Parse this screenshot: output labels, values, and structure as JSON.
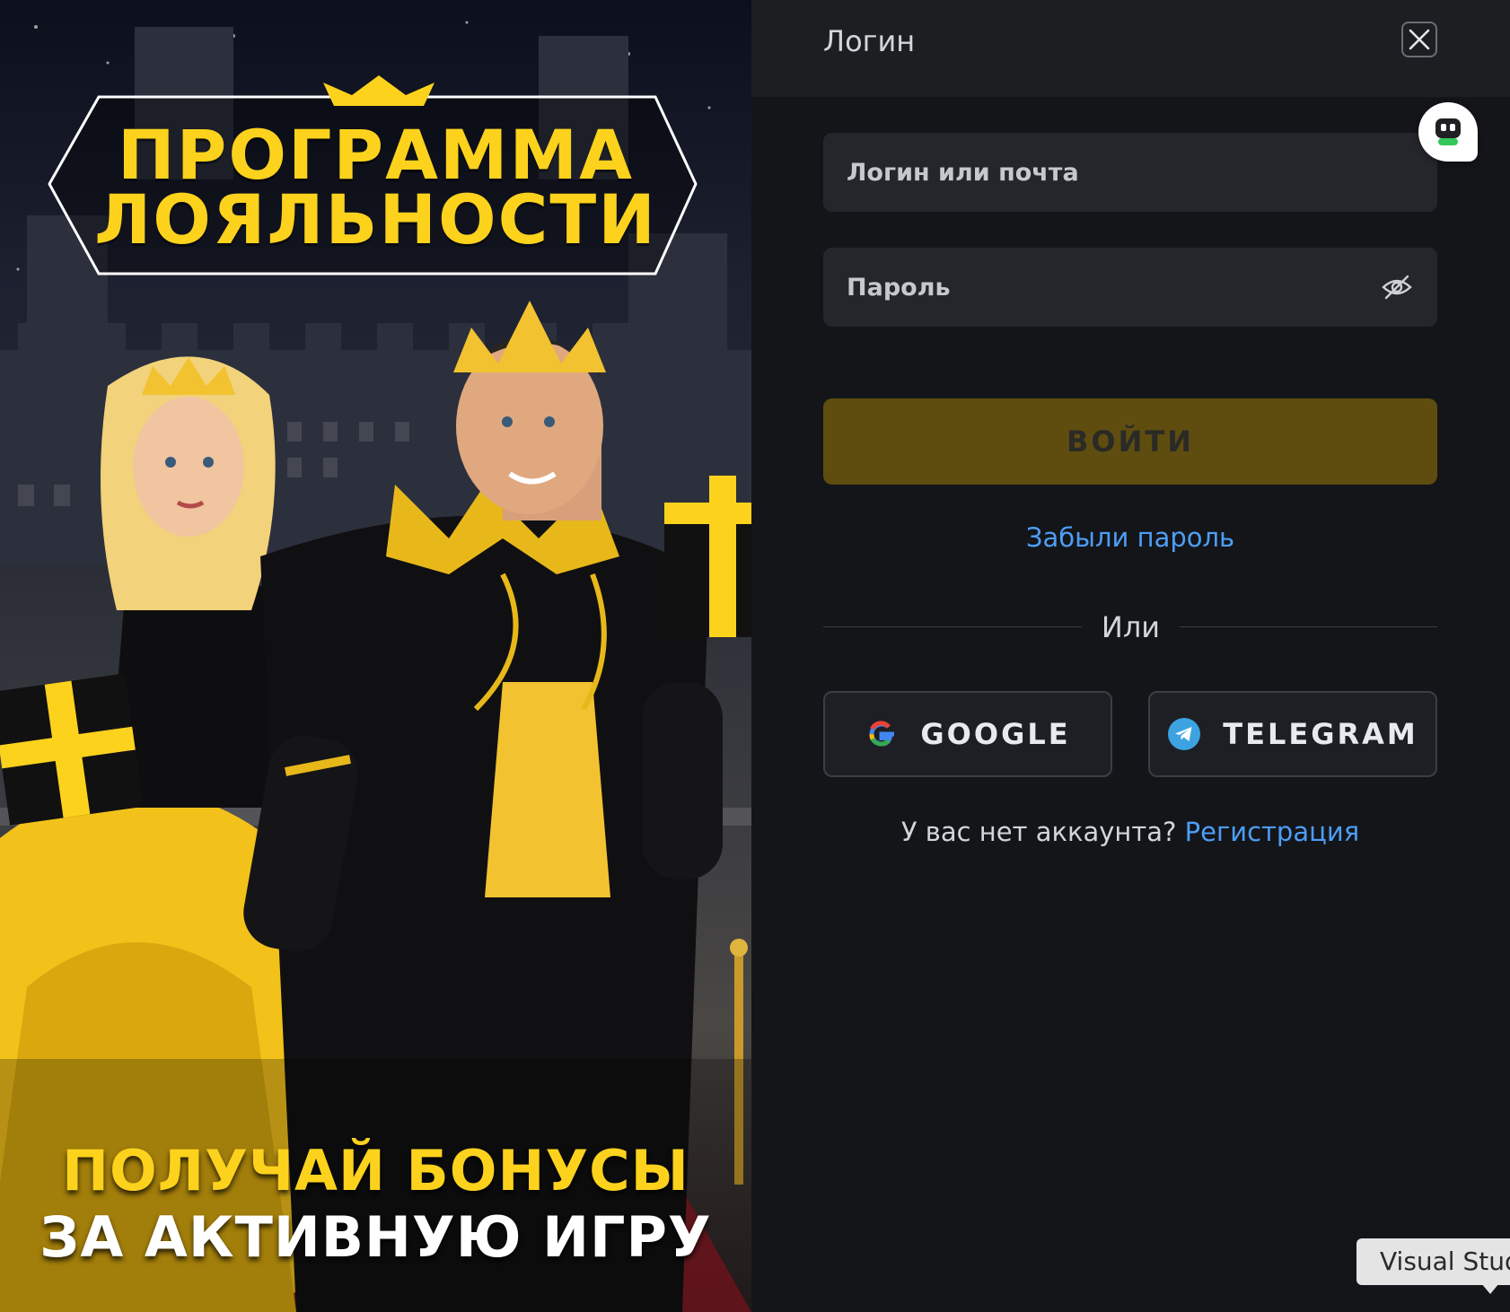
{
  "promo": {
    "title_line1": "ПРОГРАММА",
    "title_line2": "ЛОЯЛЬНОСТИ",
    "tagline_line1": "ПОЛУЧАЙ БОНУСЫ",
    "tagline_line2": "ЗА АКТИВНУЮ ИГРУ",
    "accent_color": "#fcd21d"
  },
  "modal": {
    "title": "Логин",
    "close_icon": "close-icon",
    "login_placeholder": "Логин или почта",
    "password_placeholder": "Пароль",
    "password_toggle_icon": "eye-off-icon",
    "submit_label": "ВОЙТИ",
    "forgot_label": "Забыли пароль",
    "divider_label": "Или",
    "google_label": "GOOGLE",
    "telegram_label": "TELEGRAM",
    "signup_prompt": "У вас нет аккаунта?",
    "signup_link": "Регистрация",
    "link_color": "#4c9ef6",
    "submit_color": "#5f4d10"
  },
  "chat_widget": {
    "icon": "chat-bot-icon"
  },
  "tooltip": {
    "text": "Visual Stud"
  }
}
